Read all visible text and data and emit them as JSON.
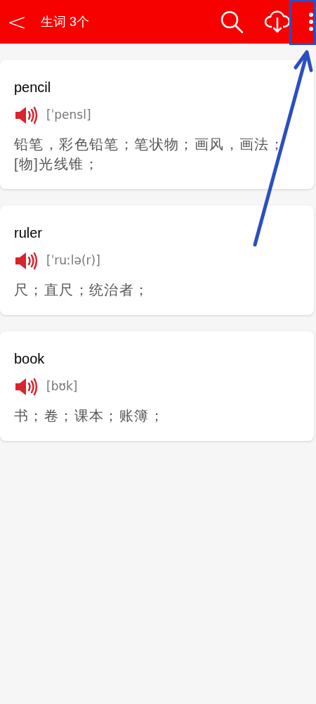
{
  "header": {
    "back": "<",
    "title": "生词 3个"
  },
  "words": [
    {
      "word": "pencil",
      "phonetic": "[ˈpensl]",
      "definition": "铅笔，彩色铅笔；笔状物；画风，画法；[物]光线锥；"
    },
    {
      "word": "ruler",
      "phonetic": "[ˈruːlə(r)]",
      "definition": "尺；直尺；统治者；"
    },
    {
      "word": "book",
      "phonetic": "[bʊk]",
      "definition": "书；卷；课本；账簿；"
    }
  ]
}
